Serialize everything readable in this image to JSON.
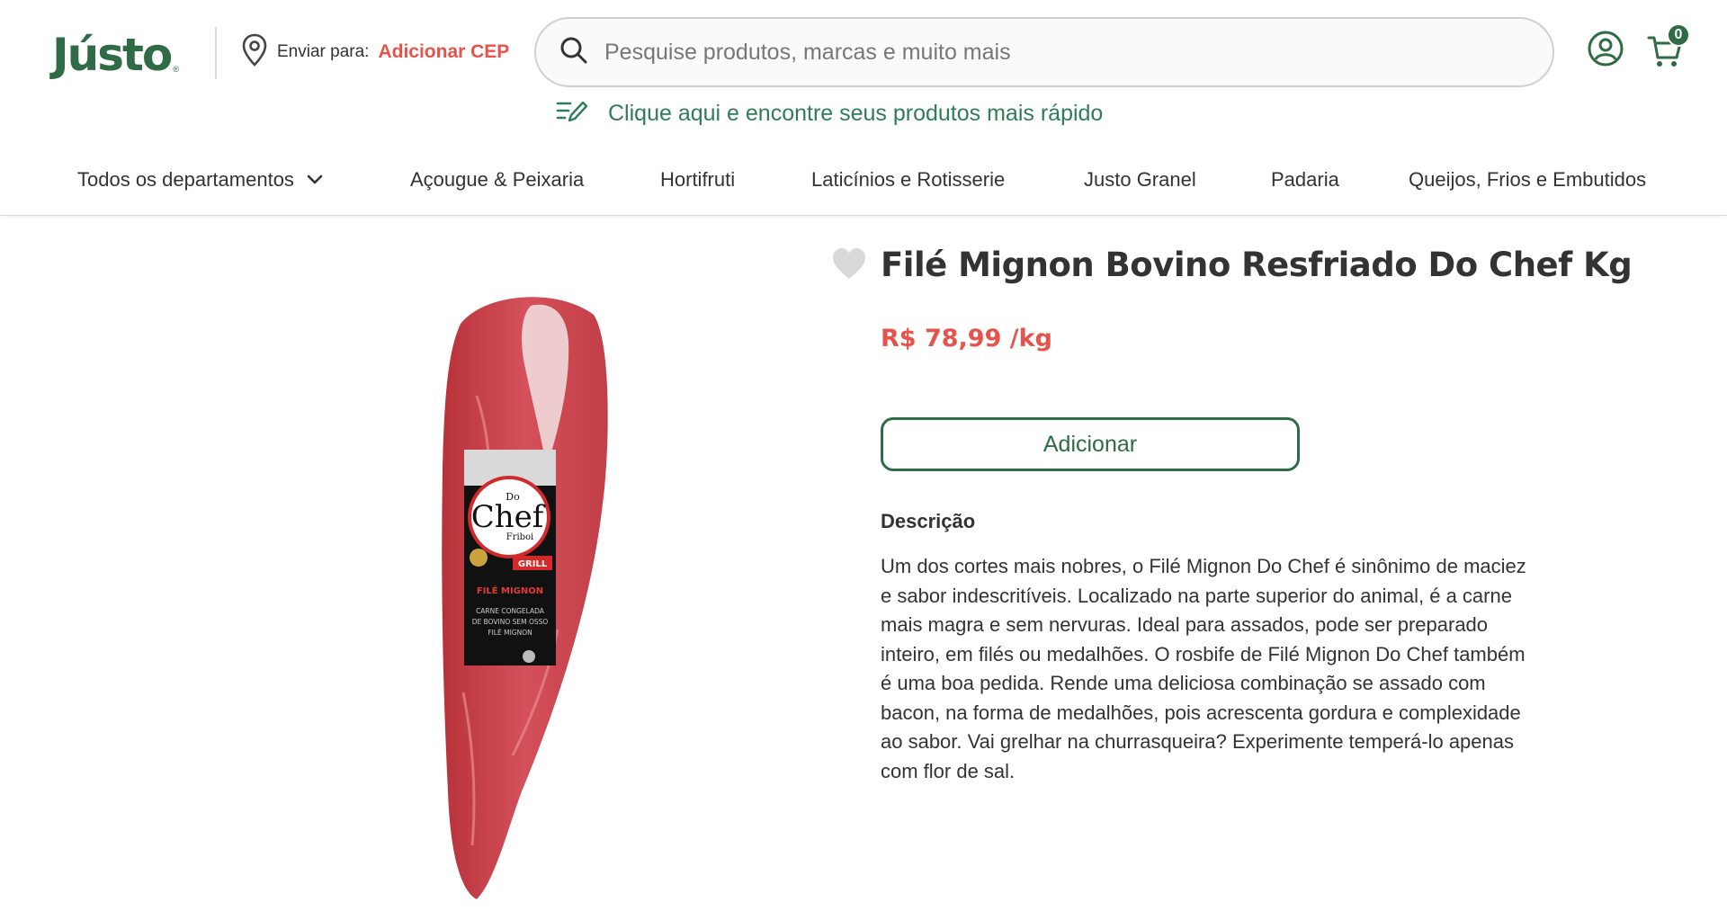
{
  "header": {
    "logo_text": "Jústo",
    "logo_mark": "®",
    "cep_label": "Enviar para:",
    "cep_link": "Adicionar CEP",
    "search_placeholder": "Pesquise produtos, marcas e muito mais",
    "cart_count": "0",
    "quick_search": "Clique aqui e encontre seus produtos mais rápido"
  },
  "nav": {
    "items": [
      "Todos os departamentos",
      "Açougue & Peixaria",
      "Hortifruti",
      "Laticínios e Rotisserie",
      "Justo Granel",
      "Padaria",
      "Queijos, Frios e Embutidos"
    ]
  },
  "product": {
    "title": "Filé Mignon Bovino Resfriado Do Chef Kg",
    "price": "R$ 78,99 /kg",
    "add_label": "Adicionar",
    "description_title": "Descrição",
    "description": "Um dos cortes mais nobres, o Filé Mignon Do Chef é sinônimo de maciez e sabor indescritíveis. Localizado na parte superior do animal, é a carne mais magra e sem nervuras. Ideal para assados, pode ser preparado inteiro, em filés ou medalhões. O rosbife de Filé Mignon Do Chef também é uma boa pedida. Rende uma deliciosa combinação se assado com bacon, na forma de medalhões, pois acrescenta gordura e complexidade ao sabor. Vai grelhar na churrasqueira? Experimente temperá-lo apenas com flor de sal.",
    "package": {
      "brand_small": "Do",
      "brand": "Chef",
      "brand_sub": "Friboi",
      "grill": "GRILL",
      "name": "FILÉ MIGNON",
      "line1": "CARNE CONGELADA",
      "line2": "DE BOVINO SEM OSSO",
      "line3": "FILÉ MIGNON"
    }
  },
  "colors": {
    "brand_green": "#2f6b44",
    "link_green": "#2f7d58",
    "price_red": "#e5534b"
  },
  "icons": {
    "location": "map-pin-icon",
    "search": "search-icon",
    "account": "user-circle-icon",
    "cart": "cart-icon",
    "quick": "list-pencil-icon",
    "dropdown": "chevron-down-icon",
    "favorite": "heart-icon"
  }
}
